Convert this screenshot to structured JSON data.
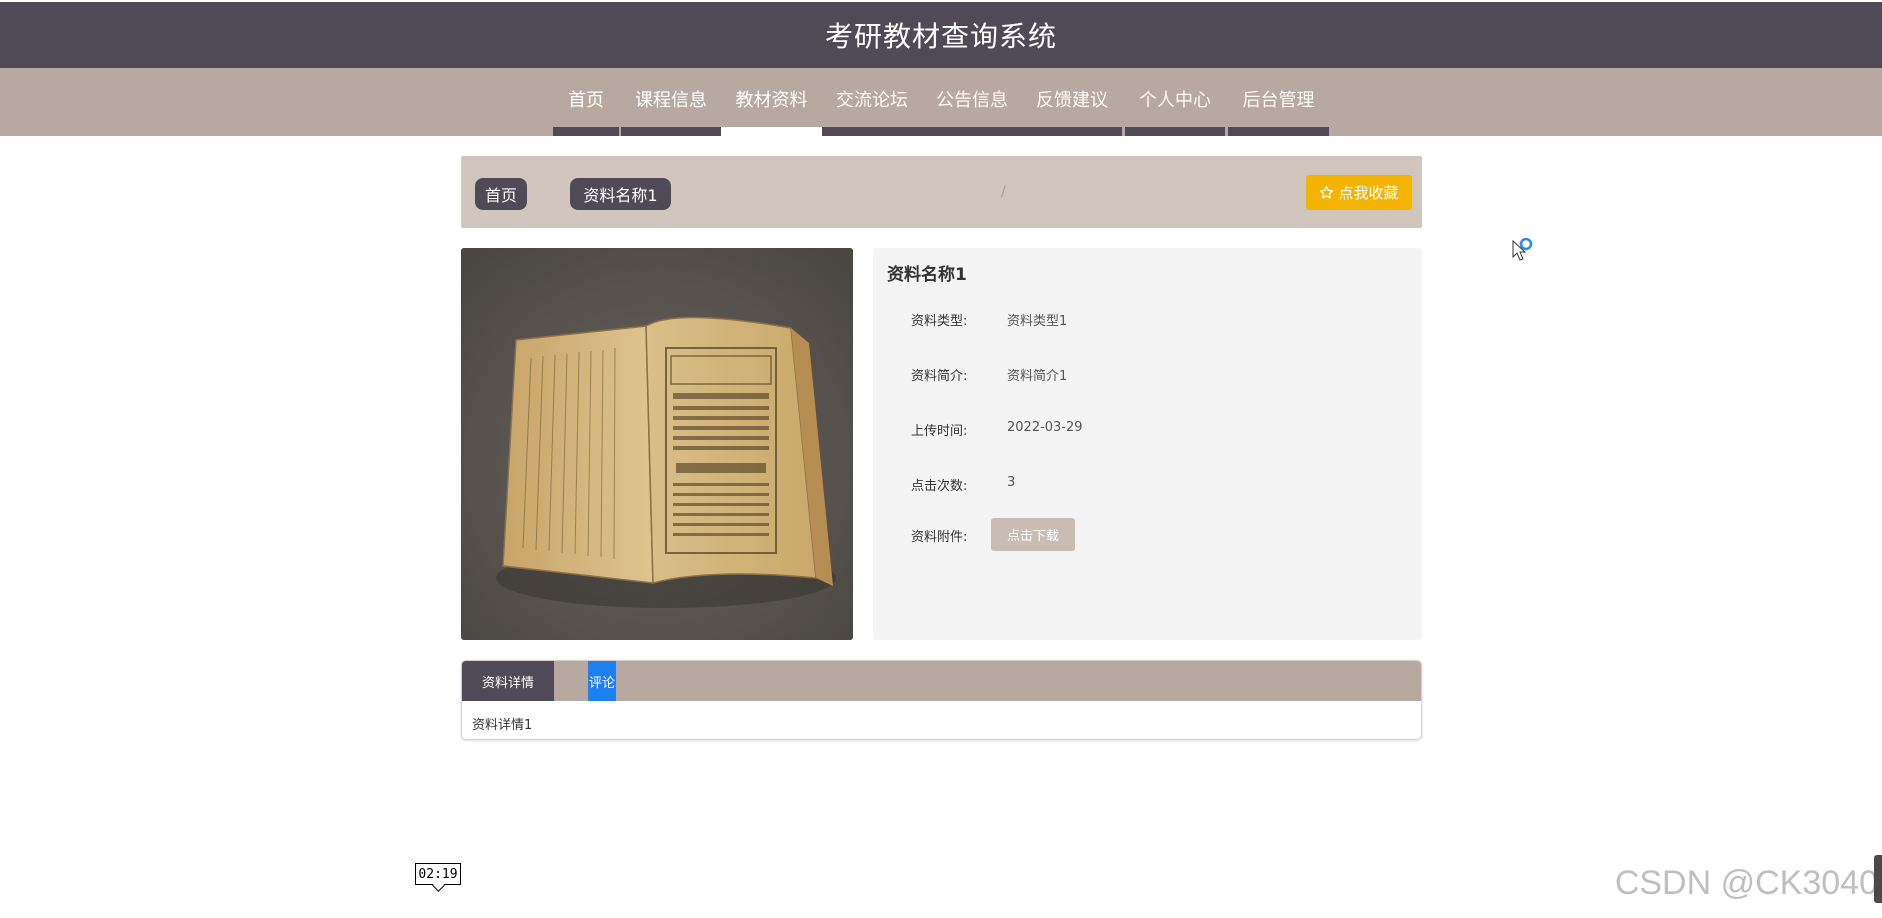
{
  "header": {
    "title": "考研教材查询系统"
  },
  "nav": {
    "items": [
      {
        "label": "首页"
      },
      {
        "label": "课程信息"
      },
      {
        "label": "教材资料"
      },
      {
        "label": "交流论坛"
      },
      {
        "label": "公告信息"
      },
      {
        "label": "反馈建议"
      },
      {
        "label": "个人中心"
      },
      {
        "label": "后台管理"
      }
    ],
    "active_index": 2
  },
  "breadcrumb": {
    "home": "首页",
    "separator": "/",
    "current": "资料名称1",
    "favorite_label": "点我收藏",
    "favorite_icon": "star-outline-icon"
  },
  "detail": {
    "name": "资料名称1",
    "fields": [
      {
        "label": "资料类型:",
        "value": "资料类型1"
      },
      {
        "label": "资料简介:",
        "value": "资料简介1"
      },
      {
        "label": "上传时间:",
        "value": "2022-03-29"
      },
      {
        "label": "点击次数:",
        "value": "3"
      },
      {
        "label": "资料附件:"
      }
    ],
    "download_label": "点击下载"
  },
  "tabs": {
    "items": [
      {
        "label": "资料详情"
      },
      {
        "label": "评论"
      }
    ],
    "content": "资料详情1"
  },
  "overlay": {
    "timer": "02:19",
    "watermark": "CSDN @CK3040"
  },
  "colors": {
    "header_bg": "#4f4a56",
    "nav_bg": "#b7a99f",
    "breadcrumb_bg": "#d1c6bd",
    "favorite_bg": "#f5b400",
    "download_bg": "#c9bdb3",
    "comment_tab_bg": "#1e7ff1"
  }
}
